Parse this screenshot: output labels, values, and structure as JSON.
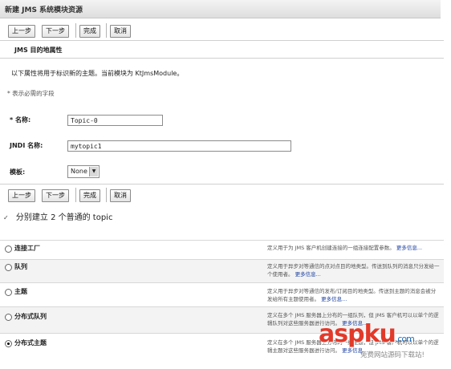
{
  "window": {
    "title": "新建 JMS 系统模块资源"
  },
  "buttons": {
    "prev": "上一步",
    "next": "下一步",
    "finish": "完成",
    "cancel": "取消"
  },
  "section": {
    "heading": "JMS 目的地属性",
    "intro": "以下属性将用于标识新的主题。当前模块为 KtJmsModule。",
    "required_note": "* 表示必需的字段"
  },
  "form": {
    "name_label": "* 名称:",
    "name_value": "Topic-0",
    "jndi_label": "JNDI 名称:",
    "jndi_value": "mytopic1",
    "template_label": "模板:",
    "template_value": "None"
  },
  "doc_text": "分别建立 2 个普通的 topic",
  "resource_types": [
    {
      "label": "连接工厂",
      "desc": "定义用于为 JMS 客户机创建连接的一组连接配置参数。",
      "more": "更多信息...",
      "selected": false
    },
    {
      "label": "队列",
      "desc": "定义用于异步对等通信的点对点目的地类型。传送到队列的消息只分发给一个使用者。",
      "more": "更多信息...",
      "selected": false
    },
    {
      "label": "主题",
      "desc": "定义用于异步对等通信的发布/订阅目的地类型。传送到主题的消息会被分发给所有主题使用者。",
      "more": "更多信息...",
      "selected": false
    },
    {
      "label": "分布式队列",
      "desc": "定义在多个 JMS 服务器上分布的一组队列，但 JMS 客户机可以以单个的逻辑队列对这些服务器进行访问。",
      "more": "更多信息...",
      "selected": false
    },
    {
      "label": "分布式主题",
      "desc": "定义在多个 JMS 服务器上分布的一组主题，但 JMS 客户机可以以单个的逻辑主题对这些服务器进行访问。",
      "more": "更多信息...",
      "selected": true
    }
  ],
  "watermark": {
    "brand": "aspku",
    "domain": ".com",
    "slogan": "免费网站源码下载站!"
  },
  "colors": {
    "brand_red": "#e23a2a",
    "brand_blue": "#1b6fc4",
    "link": "#1a3fa0"
  }
}
